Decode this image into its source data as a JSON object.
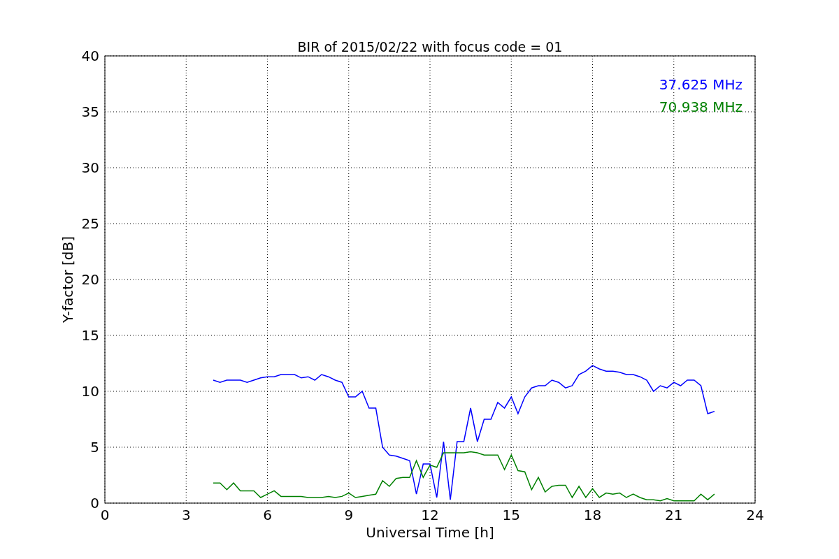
{
  "figure": {
    "chart_data": {
      "type": "line",
      "title": "BIR of 2015/02/22 with focus code = 01",
      "xlabel": "Universal Time [h]",
      "ylabel": "Y-factor [dB]",
      "x": [
        4,
        4.25,
        4.5,
        4.75,
        5,
        5.25,
        5.5,
        5.75,
        6,
        6.25,
        6.5,
        6.75,
        7,
        7.25,
        7.5,
        7.75,
        8,
        8.25,
        8.5,
        8.75,
        9,
        9.25,
        9.5,
        9.75,
        10,
        10.25,
        10.5,
        10.75,
        11,
        11.25,
        11.5,
        11.75,
        12,
        12.25,
        12.5,
        12.75,
        13,
        13.25,
        13.5,
        13.75,
        14,
        14.25,
        14.5,
        14.75,
        15,
        15.25,
        15.5,
        15.75,
        16,
        16.25,
        16.5,
        16.75,
        17,
        17.25,
        17.5,
        17.75,
        18,
        18.25,
        18.5,
        18.75,
        19,
        19.25,
        19.5,
        19.75,
        20,
        20.25,
        20.5,
        20.75,
        21,
        21.25,
        21.5,
        21.75,
        22,
        22.25,
        22.5
      ],
      "series": [
        {
          "name": "37.625 MHz",
          "color": "#0000ff",
          "values": [
            11,
            10.8,
            11,
            11,
            11,
            10.8,
            11,
            11.2,
            11.3,
            11.3,
            11.5,
            11.5,
            11.5,
            11.2,
            11.3,
            11,
            11.5,
            11.3,
            11,
            10.8,
            9.5,
            9.5,
            10,
            8.5,
            8.5,
            5,
            4.3,
            4.2,
            4,
            3.8,
            0.8,
            3.5,
            3.5,
            0.5,
            5.5,
            0.3,
            5.5,
            5.5,
            8.5,
            5.5,
            7.5,
            7.5,
            9,
            8.5,
            9.5,
            8,
            9.5,
            10.3,
            10.5,
            10.5,
            11,
            10.8,
            10.3,
            10.5,
            11.5,
            11.8,
            12.3,
            12,
            11.8,
            11.8,
            11.7,
            11.5,
            11.5,
            11.3,
            11,
            10,
            10.5,
            10.3,
            10.8,
            10.5,
            11,
            11,
            10.5,
            8,
            8.2
          ]
        },
        {
          "name": "70.938 MHz",
          "color": "#008000",
          "values": [
            1.8,
            1.8,
            1.2,
            1.8,
            1.1,
            1.1,
            1.1,
            0.5,
            0.8,
            1.1,
            0.6,
            0.6,
            0.6,
            0.6,
            0.5,
            0.5,
            0.5,
            0.6,
            0.5,
            0.6,
            0.9,
            0.5,
            0.6,
            0.7,
            0.8,
            2,
            1.5,
            2.2,
            2.3,
            2.3,
            3.8,
            2.3,
            3.4,
            3.2,
            4.5,
            4.5,
            4.5,
            4.5,
            4.6,
            4.5,
            4.3,
            4.3,
            4.3,
            3,
            4.3,
            2.9,
            2.8,
            1.2,
            2.3,
            1,
            1.5,
            1.6,
            1.6,
            0.5,
            1.5,
            0.5,
            1.3,
            0.5,
            0.9,
            0.8,
            0.9,
            0.5,
            0.8,
            0.5,
            0.3,
            0.3,
            0.2,
            0.4,
            0.2,
            0.2,
            0.2,
            0.2,
            0.8,
            0.3,
            0.8
          ]
        }
      ],
      "grid": true,
      "xlim": [
        0,
        24
      ],
      "ylim": [
        0,
        40
      ],
      "xticks": [
        0,
        3,
        6,
        9,
        12,
        15,
        18,
        21,
        24
      ],
      "yticks": [
        0,
        5,
        10,
        15,
        20,
        25,
        30,
        35,
        40
      ]
    }
  }
}
